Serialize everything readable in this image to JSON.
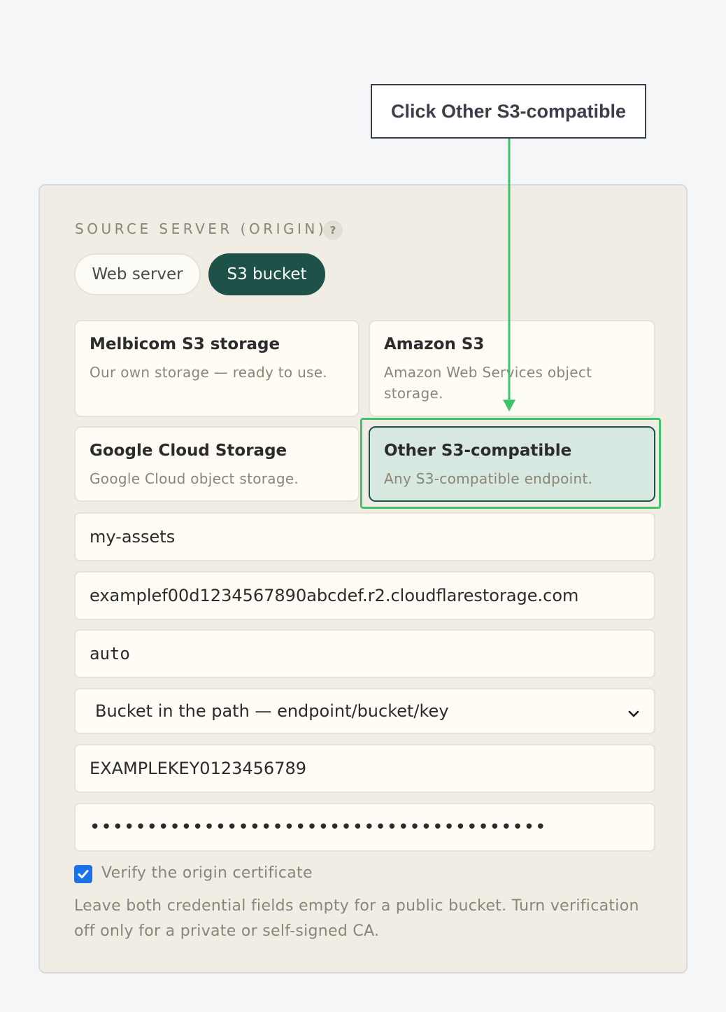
{
  "annotation": {
    "callout_text": "Click Other S3-compatible"
  },
  "section": {
    "label": "SOURCE SERVER (ORIGIN)",
    "help_glyph": "?"
  },
  "origin_type": {
    "options": [
      "Web server",
      "S3 bucket"
    ],
    "selected": "S3 bucket"
  },
  "providers": [
    {
      "title": "Melbicom S3 storage",
      "description": "Our own storage — ready to use."
    },
    {
      "title": "Amazon S3",
      "description": "Amazon Web Services object storage."
    },
    {
      "title": "Google Cloud Storage",
      "description": "Google Cloud object storage."
    },
    {
      "title": "Other S3-compatible",
      "description": "Any S3-compatible endpoint."
    }
  ],
  "selected_provider": "Other S3-compatible",
  "fields": {
    "bucket": "my-assets",
    "endpoint": "examplef00d1234567890abcdef.r2.cloudflarestorage.com",
    "region": "auto",
    "addressing_style": "Bucket in the path — endpoint/bucket/key",
    "access_key": "EXAMPLEKEY0123456789",
    "secret_key_masked": "••••••••••••••••••••••••••••••••••••••••"
  },
  "verify_certificate": {
    "checked": true,
    "label": "Verify the origin certificate"
  },
  "help_text": "Leave both credential fields empty for a public bucket. Turn verification off only for a private or self-signed CA.",
  "colors": {
    "accent": "#1e5248",
    "selected_card_bg": "#d6e8e0",
    "highlight": "#3fc46e",
    "checkbox": "#1a73e8"
  }
}
